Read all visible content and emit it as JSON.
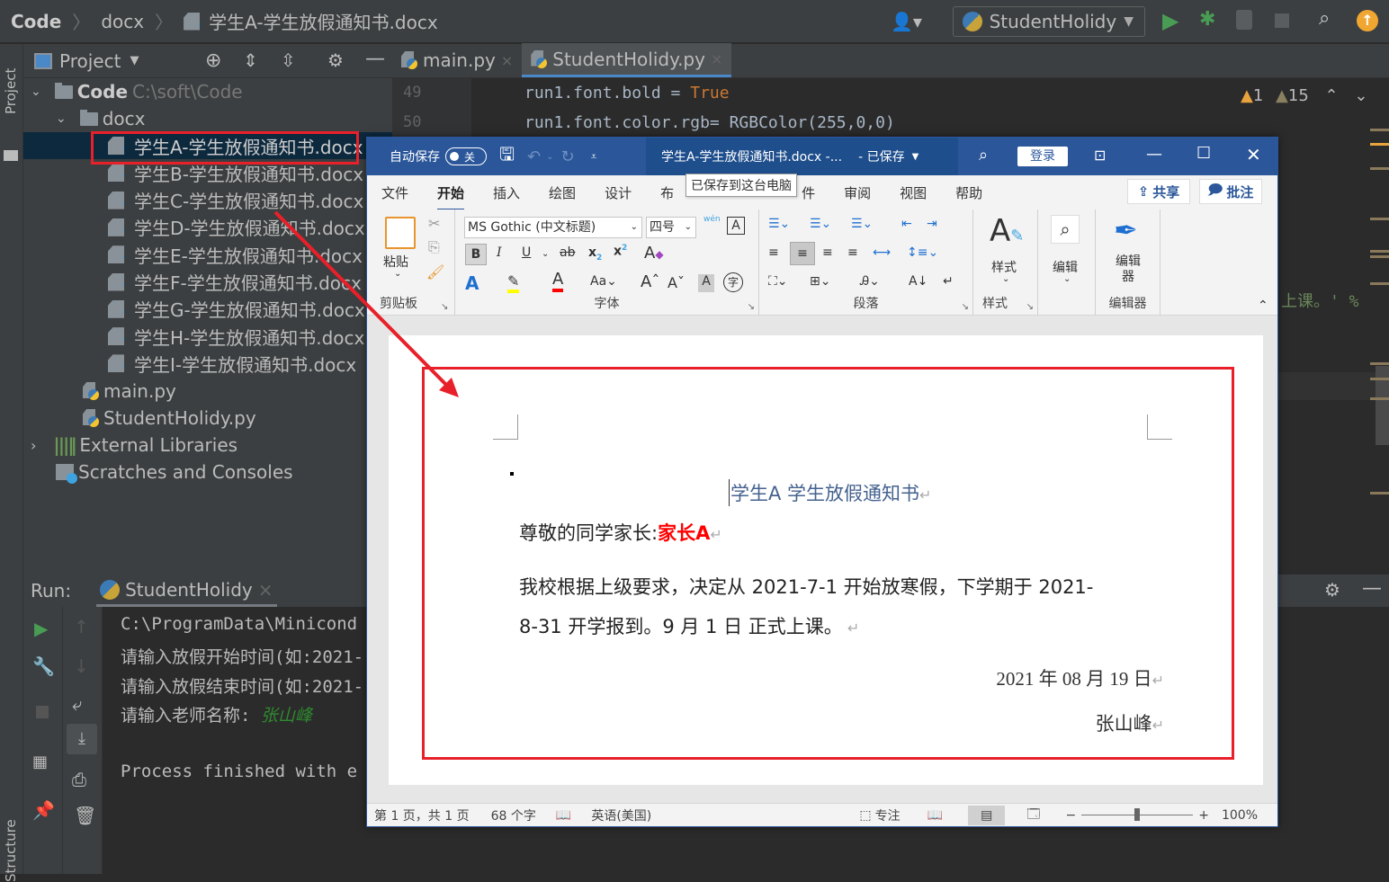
{
  "ide": {
    "breadcrumb": [
      "Code",
      "docx",
      "学生A-学生放假通知书.docx"
    ],
    "run_config": "StudentHolidy",
    "project_panel": {
      "title": "Project",
      "root": {
        "name": "Code",
        "path": "C:\\soft\\Code"
      },
      "folder": "docx",
      "files": [
        "学生A-学生放假通知书.docx",
        "学生B-学生放假通知书.docx",
        "学生C-学生放假通知书.docx",
        "学生D-学生放假通知书.docx",
        "学生E-学生放假通知书.docx",
        "学生F-学生放假通知书.docx",
        "学生G-学生放假通知书.docx",
        "学生H-学生放假通知书.docx",
        "学生I-学生放假通知书.docx"
      ],
      "py_files": [
        "main.py",
        "StudentHolidy.py"
      ],
      "external_libraries": "External Libraries",
      "scratches": "Scratches and Consoles"
    },
    "left_strip": {
      "project": "Project",
      "structure": "Structure"
    },
    "editor": {
      "tabs": [
        "main.py",
        "StudentHolidy.py"
      ],
      "active_tab": 1,
      "lines": [
        {
          "num": "49",
          "code": "run1.font.bold = ",
          "kw": "True"
        },
        {
          "num": "50",
          "code": "run1.font.color.rgb= RGBColor(255,0,0)"
        }
      ],
      "partial_text": "上课。' %",
      "warnings": {
        "count1": "1",
        "count2": "15"
      }
    },
    "run_panel": {
      "label": "Run:",
      "tab": "StudentHolidy",
      "lines": [
        "C:\\ProgramData\\Minicond",
        "请输入放假开始时间(如:2021-",
        "请输入放假结束时间(如:2021-",
        "请输入老师名称: "
      ],
      "input_value": "张山峰",
      "finished": "Process finished with e"
    }
  },
  "word": {
    "autosave_label": "自动保存",
    "autosave_state": "关",
    "title": "学生A-学生放假通知书.docx  -...",
    "saved_status": "- 已保存",
    "tooltip": "已保存到这台电脑",
    "login_button": "登录",
    "tabs": [
      "文件",
      "开始",
      "插入",
      "绘图",
      "设计",
      "布",
      "件",
      "审阅",
      "视图",
      "帮助"
    ],
    "active_tab": "开始",
    "share_button": "共享",
    "comment_button": "批注",
    "ribbon": {
      "clipboard": {
        "paste": "粘贴",
        "label": "剪贴板"
      },
      "font": {
        "name": "MS Gothic (中文标题)",
        "size": "四号",
        "label": "字体",
        "pinyin": "wén"
      },
      "paragraph": {
        "label": "段落"
      },
      "styles": {
        "button": "样式",
        "label": "样式"
      },
      "editing": {
        "button": "编辑"
      },
      "editor": {
        "button": "编辑器",
        "label": "编辑器"
      }
    },
    "document": {
      "title": "学生A 学生放假通知书",
      "greeting": "尊敬的同学家长:",
      "parent_name": "家长A",
      "body_line1": "我校根据上级要求，决定从 2021-7-1 开始放寒假，下学期于 2021-",
      "body_line2": "8-31 开学报到。9 月 1 日 正式上课。",
      "date": "2021 年 08 月 19 日",
      "signature": "张山峰"
    },
    "status": {
      "page": "第 1 页，共 1 页",
      "words": "68 个字",
      "language": "英语(美国)",
      "focus": "专注",
      "zoom": "100%",
      "zoom_level": 1.0
    }
  },
  "colors": {
    "ide_bg": "#2b2b2b",
    "ide_panel": "#3c3f41",
    "word_blue": "#2b579a",
    "annotation_red": "#e8202a",
    "doc_title_blue": "#44628f",
    "parent_red": "#ff0000"
  }
}
